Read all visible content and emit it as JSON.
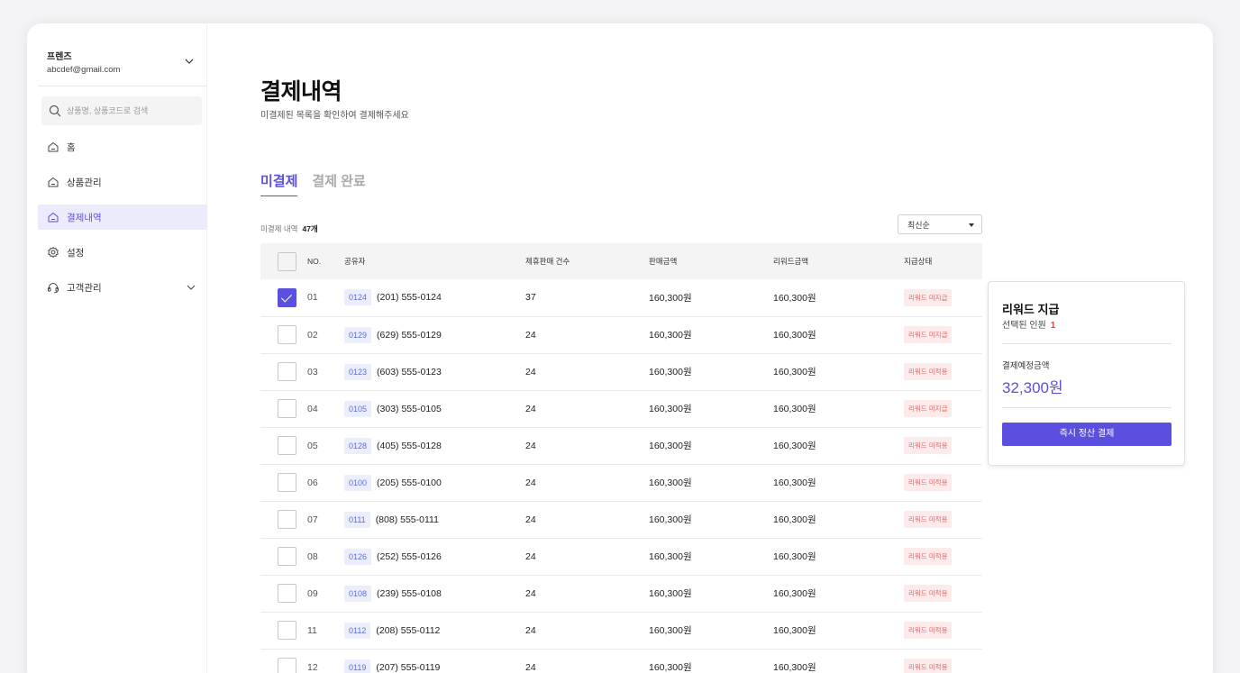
{
  "account": {
    "name": "프렌즈",
    "email": "abcdef@gmail.com"
  },
  "search": {
    "placeholder": "상품명, 상품코드로 검색"
  },
  "nav": [
    {
      "label": "홈",
      "icon": "home-icon"
    },
    {
      "label": "상품관리",
      "icon": "home-icon"
    },
    {
      "label": "결제내역",
      "icon": "home-icon",
      "active": true
    },
    {
      "label": "설정",
      "icon": "gear-icon"
    },
    {
      "label": "고객관리",
      "icon": "headset-icon",
      "expandable": true
    }
  ],
  "page": {
    "title": "결제내역",
    "subtitle": "미결제된 목록을 확인하여 결제해주세요"
  },
  "tabs": [
    {
      "label": "미결제",
      "active": true
    },
    {
      "label": "결제 완료"
    }
  ],
  "list": {
    "count_label": "미결제 내역",
    "count_value": "47개",
    "sort_value": "최신순"
  },
  "table": {
    "headers": [
      "NO.",
      "공유자",
      "제휴판매 건수",
      "판매금액",
      "리워드금액",
      "지급상태"
    ],
    "rows": [
      {
        "checked": true,
        "no": "01",
        "code": "0124",
        "phone": "(201) 555-0124",
        "count": "37",
        "sales": "160,300원",
        "reward": "160,300원",
        "status": "리워드 미지급"
      },
      {
        "checked": false,
        "no": "02",
        "code": "0129",
        "phone": "(629) 555-0129",
        "count": "24",
        "sales": "160,300원",
        "reward": "160,300원",
        "status": "리워드 미지급"
      },
      {
        "checked": false,
        "no": "03",
        "code": "0123",
        "phone": "(603) 555-0123",
        "count": "24",
        "sales": "160,300원",
        "reward": "160,300원",
        "status": "리워드 미적용"
      },
      {
        "checked": false,
        "no": "04",
        "code": "0105",
        "phone": "(303) 555-0105",
        "count": "24",
        "sales": "160,300원",
        "reward": "160,300원",
        "status": "리워드 미지급"
      },
      {
        "checked": false,
        "no": "05",
        "code": "0128",
        "phone": "(405) 555-0128",
        "count": "24",
        "sales": "160,300원",
        "reward": "160,300원",
        "status": "리워드 미적용"
      },
      {
        "checked": false,
        "no": "06",
        "code": "0100",
        "phone": "(205) 555-0100",
        "count": "24",
        "sales": "160,300원",
        "reward": "160,300원",
        "status": "리워드 미적용"
      },
      {
        "checked": false,
        "no": "07",
        "code": "0111",
        "phone": "(808) 555-0111",
        "count": "24",
        "sales": "160,300원",
        "reward": "160,300원",
        "status": "리워드 미적용"
      },
      {
        "checked": false,
        "no": "08",
        "code": "0126",
        "phone": "(252) 555-0126",
        "count": "24",
        "sales": "160,300원",
        "reward": "160,300원",
        "status": "리워드 미적용"
      },
      {
        "checked": false,
        "no": "09",
        "code": "0108",
        "phone": "(239) 555-0108",
        "count": "24",
        "sales": "160,300원",
        "reward": "160,300원",
        "status": "리워드 미적용"
      },
      {
        "checked": false,
        "no": "11",
        "code": "0112",
        "phone": "(208) 555-0112",
        "count": "24",
        "sales": "160,300원",
        "reward": "160,300원",
        "status": "리워드 미적용"
      },
      {
        "checked": false,
        "no": "12",
        "code": "0119",
        "phone": "(207) 555-0119",
        "count": "24",
        "sales": "160,300원",
        "reward": "160,300원",
        "status": "리워드 미적용"
      }
    ]
  },
  "reward_panel": {
    "title": "리워드 지급",
    "selected_label": "선택된 인원",
    "selected_value": "1",
    "amount_label": "결제예정금액",
    "amount_value": "32,300원",
    "button_label": "즉시 정산 결제"
  },
  "colors": {
    "accent": "#5b4fe0",
    "badge_bg": "#fdeaea",
    "badge_text": "#e06a6a",
    "code_bg": "#eceefc"
  }
}
